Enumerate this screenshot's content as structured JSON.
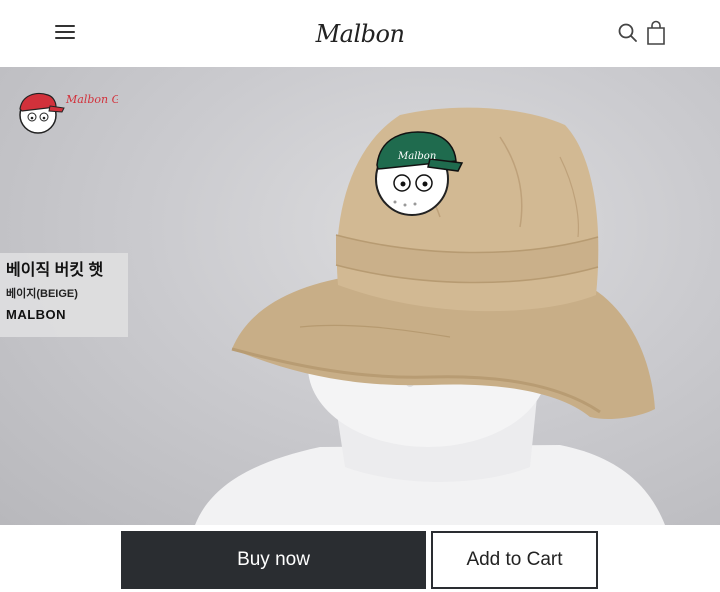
{
  "header": {
    "logo_text": "Malbon",
    "menu_icon": "hamburger-menu-icon",
    "search_icon": "search-icon",
    "bag_icon": "shopping-bag-icon"
  },
  "hero": {
    "brand_badge_text": "Malbon Golf",
    "hat_patch_text": "Malbon",
    "colors": {
      "hat": "#cdb48f",
      "patch_cap": "#1f6b4e",
      "badge_cap": "#d2313b"
    }
  },
  "product": {
    "title": "베이직 버킷 햇",
    "color": "베이지(BEIGE)",
    "brand": "MALBON"
  },
  "actions": {
    "buy_now": "Buy now",
    "add_to_cart": "Add to Cart"
  }
}
